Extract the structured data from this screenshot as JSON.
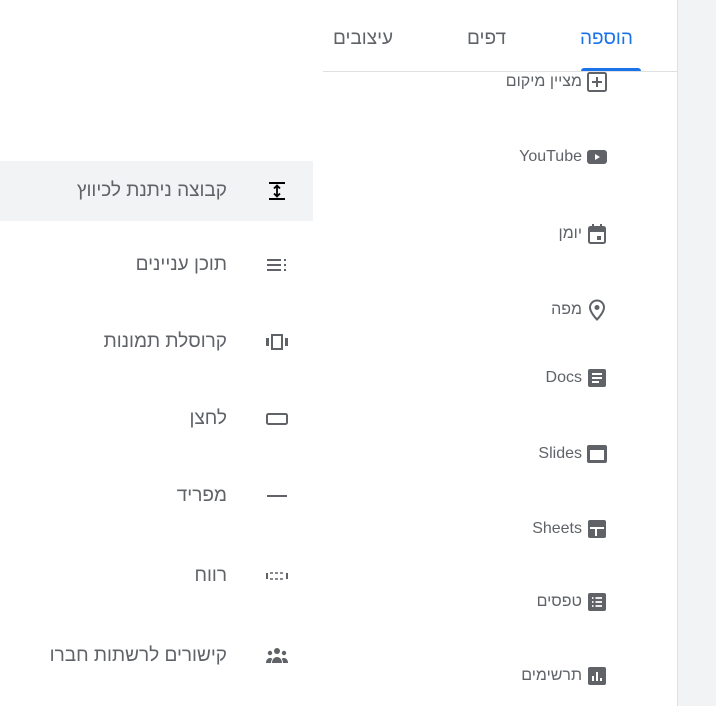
{
  "tabs": {
    "insert": "הוספה",
    "pages": "דפים",
    "themes": "עיצובים"
  },
  "insert_items": [
    {
      "label": "מציין מיקום",
      "icon": "placeholder-add-icon"
    },
    {
      "label": "YouTube",
      "icon": "youtube-icon"
    },
    {
      "label": "יומן",
      "icon": "calendar-icon"
    },
    {
      "label": "מפה",
      "icon": "map-pin-icon"
    },
    {
      "label": "Docs",
      "icon": "docs-icon"
    },
    {
      "label": "Slides",
      "icon": "slides-icon"
    },
    {
      "label": "Sheets",
      "icon": "sheets-icon"
    },
    {
      "label": "טפסים",
      "icon": "forms-icon"
    },
    {
      "label": "תרשימים",
      "icon": "charts-icon"
    }
  ],
  "layout_items": [
    {
      "label": "קבוצה ניתנת לכיווץ",
      "icon": "collapsible-group-icon"
    },
    {
      "label": "תוכן עניינים",
      "icon": "table-of-contents-icon"
    },
    {
      "label": "קרוסלת תמונות",
      "icon": "image-carousel-icon"
    },
    {
      "label": "לחצן",
      "icon": "button-icon"
    },
    {
      "label": "מפריד",
      "icon": "divider-icon"
    },
    {
      "label": "רווח",
      "icon": "spacer-icon"
    },
    {
      "label": "קישורים לרשתות חברו",
      "icon": "social-links-icon"
    }
  ],
  "colors": {
    "accent": "#1a73e8",
    "icon": "#5f6368",
    "text": "#5f6368",
    "highlight": "#f1f3f4"
  }
}
